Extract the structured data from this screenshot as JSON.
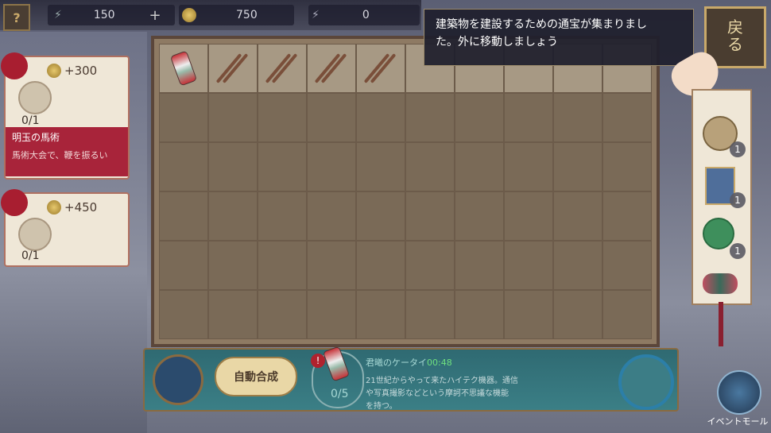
{
  "top_bar": {
    "help_label": "?",
    "energy_amount": "150",
    "plus_label": "+",
    "coin_amount": "750",
    "bolt_amount": "0"
  },
  "hint": {
    "text_line1": "建築物を建設するための通宝が集まりまし",
    "text_line2": "た。外に移動しましょう"
  },
  "back_button": {
    "label_top": "戻",
    "label_bottom": "る"
  },
  "quests": [
    {
      "reward": "+300",
      "count": "0/1",
      "title": "明玉の馬術",
      "desc": "馬術大会で、鞭を振るい"
    },
    {
      "reward": "+450",
      "count": "0/1"
    }
  ],
  "shelf": [
    {
      "icon": "pocket-watch-icon",
      "count": "1"
    },
    {
      "icon": "lantern-icon",
      "count": "1"
    },
    {
      "icon": "jade-pendant-icon",
      "count": "1"
    },
    {
      "icon": "flower-fan-icon",
      "count": ""
    }
  ],
  "bottom": {
    "auto_merge_label": "自動合成",
    "item_name": "君曦のケータイ",
    "item_timer": "00:48",
    "item_count": "0/5",
    "desc_line1": "21世紀からやって来たハイテク機器。通信",
    "desc_line2": "や写真撮影などという摩訶不思議な機能",
    "desc_line3": "を持つ。",
    "event_mall_label": "イベントモール"
  }
}
